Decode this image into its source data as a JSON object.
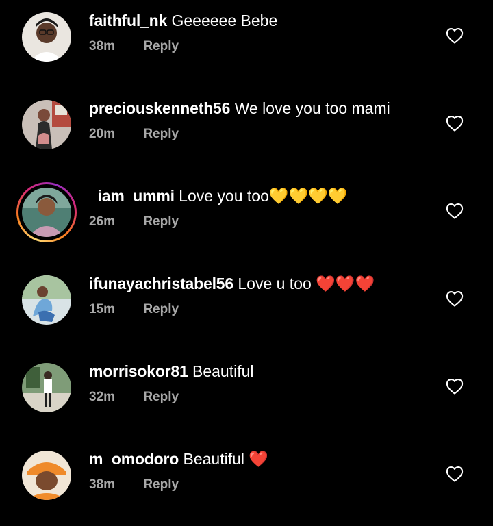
{
  "comments": [
    {
      "username": "faithful_nk",
      "text": "Geeeeee Bebe",
      "time": "38m",
      "reply": "Reply",
      "avatar_color": "#e8e3dc",
      "story": false
    },
    {
      "username": "preciouskenneth56",
      "text": "We love you too mami",
      "time": "20m",
      "reply": "Reply",
      "avatar_color": "#b7a9a2",
      "story": false
    },
    {
      "username": "_iam_ummi",
      "text": "Love you too💛💛💛💛",
      "time": "26m",
      "reply": "Reply",
      "avatar_color": "#5c8c7a",
      "story": true
    },
    {
      "username": "ifunayachristabel56",
      "text": "Love u too ❤️❤️❤️",
      "time": "15m",
      "reply": "Reply",
      "avatar_color": "#9db8c9",
      "story": false
    },
    {
      "username": "morrisokor81",
      "text": "Beautiful",
      "time": "32m",
      "reply": "Reply",
      "avatar_color": "#6f8a68",
      "story": false
    },
    {
      "username": "m_omodoro",
      "text": "Beautiful ❤️",
      "time": "38m",
      "reply": "Reply",
      "avatar_color": "#e6892e",
      "story": false
    }
  ],
  "icons": {
    "like": "heart-outline-icon"
  },
  "colors": {
    "background": "#000000",
    "text": "#ffffff",
    "secondary_text": "#a8a8a8",
    "story_ring": "#d62976",
    "heart_red": "#e0182d",
    "heart_yellow": "#f5c518"
  }
}
